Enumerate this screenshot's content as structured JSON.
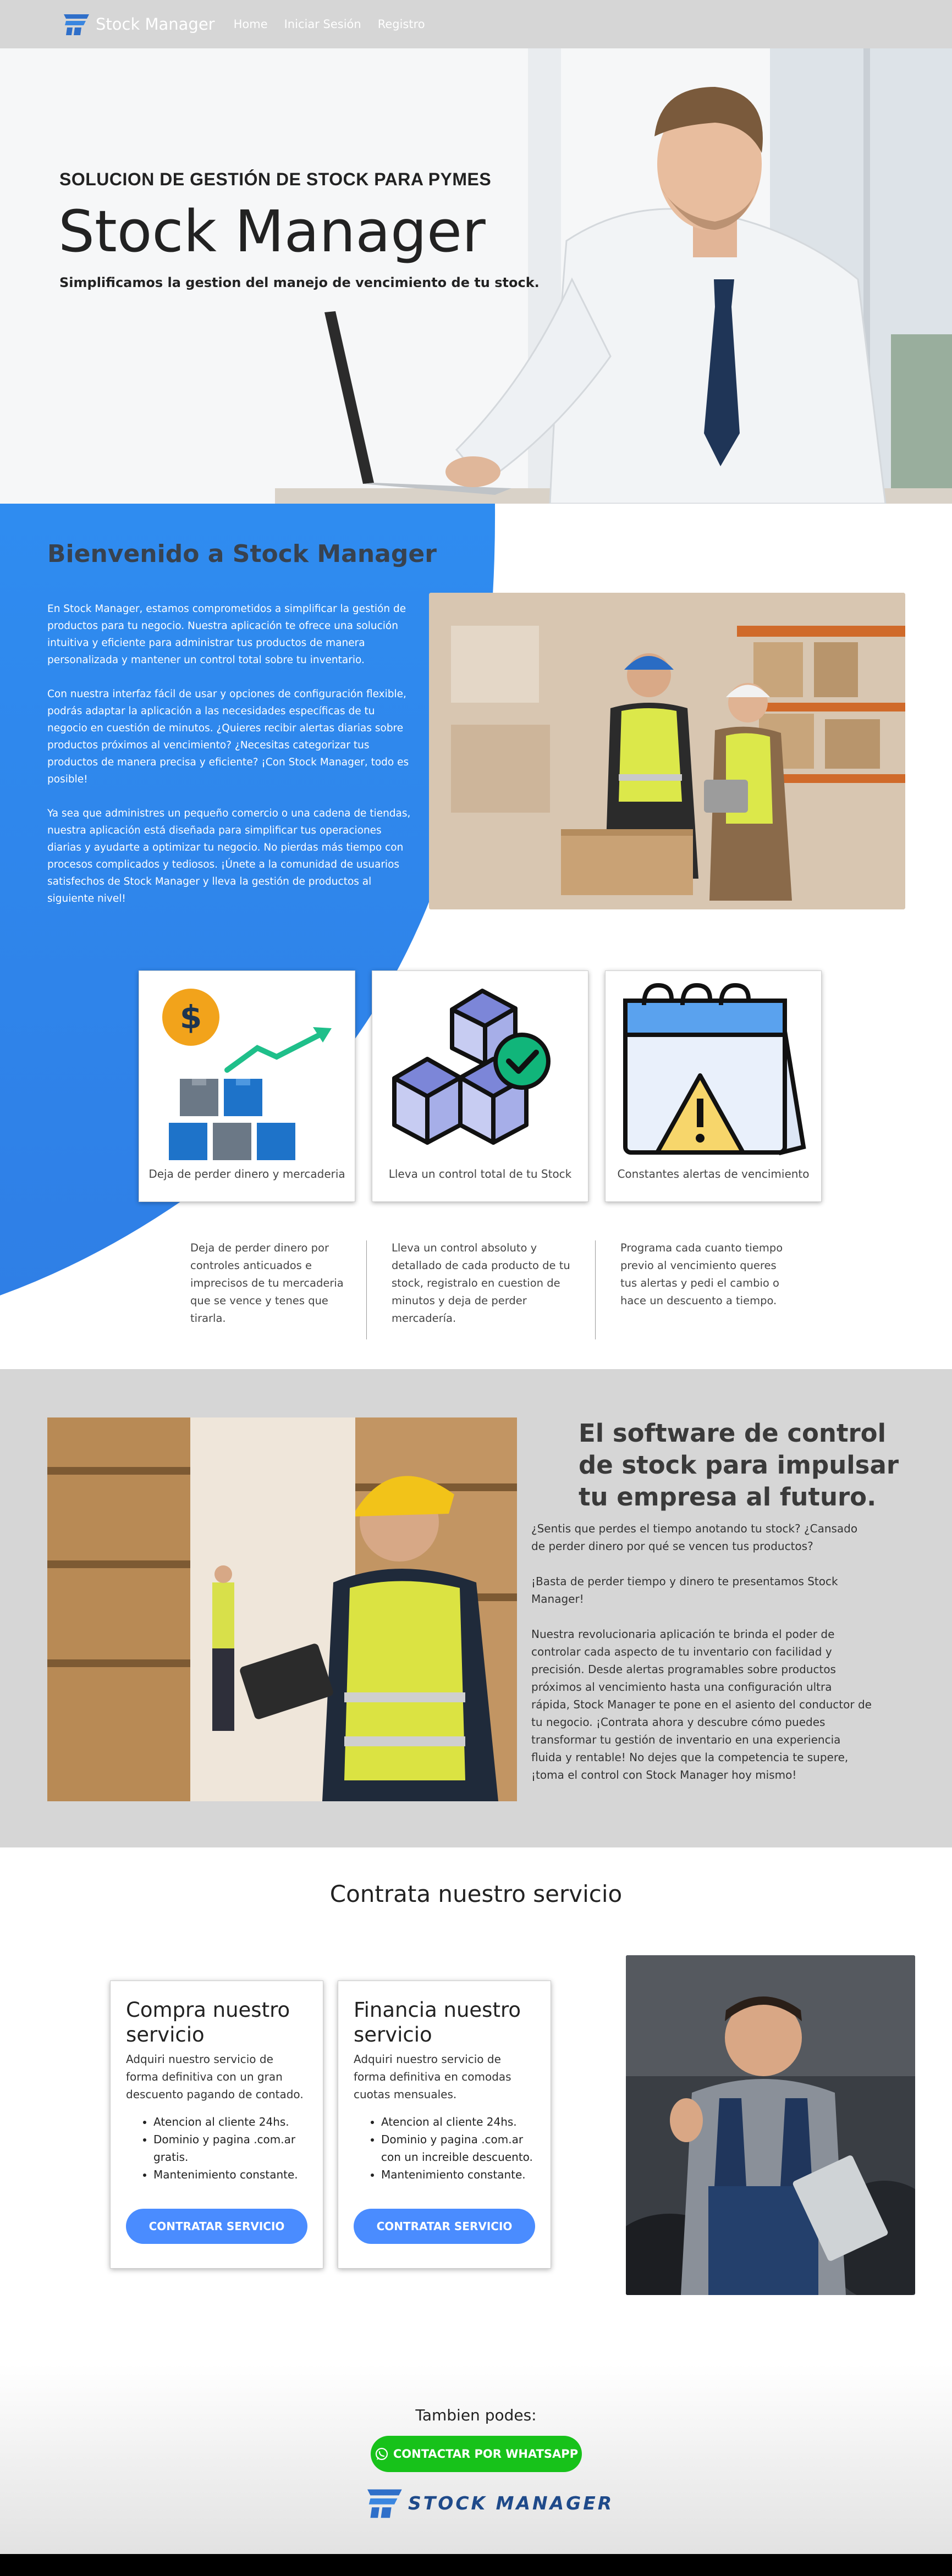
{
  "nav": {
    "brand": "Stock Manager",
    "links": [
      "Home",
      "Iniciar Sesión",
      "Registro"
    ]
  },
  "hero": {
    "kicker": "SOLUCION DE GESTIÓN DE STOCK PARA PYMES",
    "title": "Stock Manager",
    "subtitle": "Simplificamos la gestion del manejo de vencimiento de tu stock."
  },
  "welcome": {
    "title": "Bienvenido a Stock Manager",
    "paragraphs": [
      "En Stock Manager, estamos comprometidos a simplificar la gestión de productos para tu negocio. Nuestra aplicación te ofrece una solución intuitiva y eficiente para administrar tus productos de manera personalizada y mantener un control total sobre tu inventario.",
      "Con nuestra interfaz fácil de usar y opciones de configuración flexible, podrás adaptar la aplicación a las necesidades específicas de tu negocio en cuestión de minutos. ¿Quieres recibir alertas diarias sobre productos próximos al vencimiento? ¿Necesitas categorizar tus productos de manera precisa y eficiente? ¡Con Stock Manager, todo es posible!",
      "Ya sea que administres un pequeño comercio o una cadena de tiendas, nuestra aplicación está diseñada para simplificar tus operaciones diarias y ayudarte a optimizar tu negocio. No pierdas más tiempo con procesos complicados y tediosos. ¡Únete a la comunidad de usuarios satisfechos de Stock Manager y lleva la gestión de productos al siguiente nivel!"
    ],
    "cards": [
      {
        "caption": "Deja de perder dinero y mercaderia",
        "icon": "money-growth-icon"
      },
      {
        "caption": "Lleva un control total de tu Stock",
        "icon": "stock-boxes-icon"
      },
      {
        "caption": "Constantes alertas de vencimiento",
        "icon": "calendar-alert-icon"
      }
    ],
    "descriptions": [
      "Deja de perder dinero por controles anticuados e imprecisos de tu mercaderia que se vence y tenes que tirarla.",
      "Lleva un control absoluto y detallado de cada producto de tu stock, registralo en cuestion de minutos y deja de perder mercadería.",
      "Programa cada cuanto tiempo previo al vencimiento queres tus alertas y pedi el cambio o hace un descuento a tiempo."
    ]
  },
  "software": {
    "title": "El software de control de stock para impulsar tu empresa al futuro.",
    "paragraphs": [
      "¿Sentis que perdes el tiempo anotando tu stock? ¿Cansado de perder dinero por qué se vencen tus productos?",
      "¡Basta de perder tiempo y dinero te presentamos Stock Manager!",
      "Nuestra revolucionaria aplicación te brinda el poder de controlar cada aspecto de tu inventario con facilidad y precisión. Desde alertas programables sobre productos próximos al vencimiento hasta una configuración ultra rápida, Stock Manager te pone en el asiento del conductor de tu negocio. ¡Contrata ahora y descubre cómo puedes transformar tu gestión de inventario en una experiencia fluida y rentable! No dejes que la competencia te supere, ¡toma el control con Stock Manager hoy mismo!"
    ]
  },
  "service": {
    "title": "Contrata nuestro servicio",
    "plans": [
      {
        "title": "Compra nuestro servicio",
        "lead": "Adquiri nuestro servicio de forma definitiva con un gran descuento pagando de contado.",
        "features": [
          "Atencion al cliente 24hs.",
          "Dominio y pagina .com.ar gratis.",
          "Mantenimiento constante."
        ],
        "button": "CONTRATAR SERVICIO"
      },
      {
        "title": "Financia nuestro servicio",
        "lead": "Adquiri nuestro servicio de forma definitiva en comodas cuotas mensuales.",
        "features": [
          "Atencion al cliente 24hs.",
          "Dominio y pagina .com.ar con un increible descuento.",
          "Mantenimiento constante."
        ],
        "button": "CONTRATAR SERVICIO"
      }
    ]
  },
  "footer": {
    "question": "Tambien podes:",
    "whatsapp": "CONTACTAR POR WHATSAPP",
    "logo_text": "STOCK MANAGER"
  },
  "colors": {
    "accent_blue": "#2f8cf0",
    "button_blue": "#4a8cff",
    "whatsapp_green": "#17c21a",
    "nav_gray": "#d6d6d6"
  }
}
